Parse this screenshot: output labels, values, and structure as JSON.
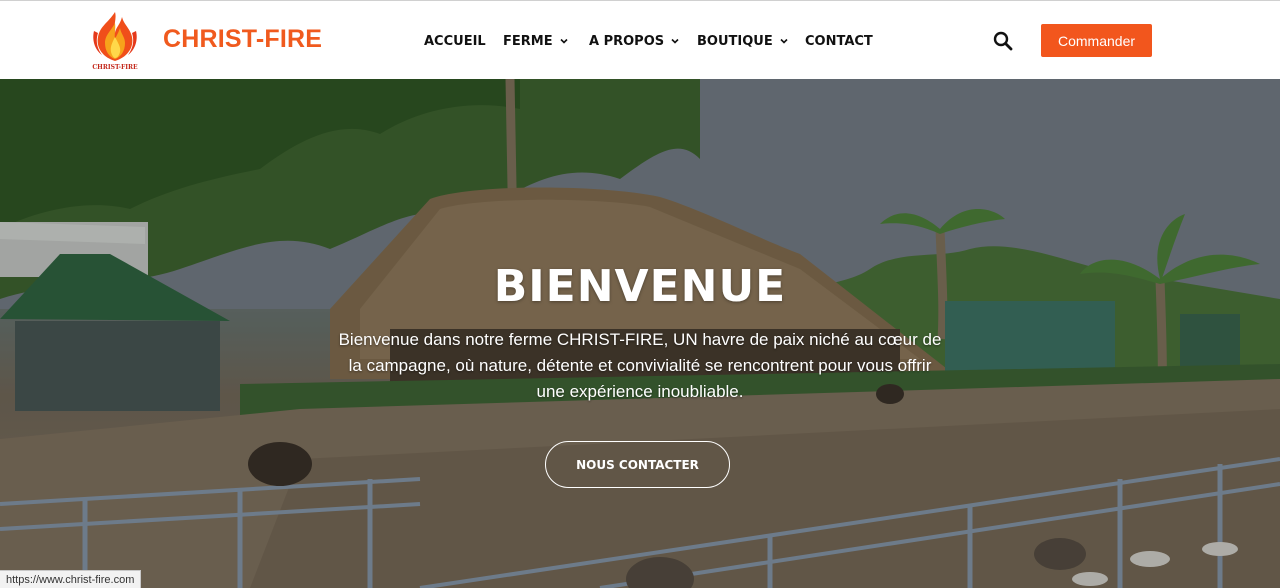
{
  "header": {
    "logo_caption": "CHRIST-FIRE",
    "brand": "CHRIST-FIRE",
    "nav": [
      {
        "label": "ACCUEIL",
        "dropdown": false
      },
      {
        "label": "FERME",
        "dropdown": true
      },
      {
        "label": "A PROPOS",
        "dropdown": true
      },
      {
        "label": "BOUTIQUE",
        "dropdown": true
      },
      {
        "label": "CONTACT",
        "dropdown": false
      }
    ],
    "search_icon": "search-icon",
    "order_label": "Commander"
  },
  "hero": {
    "title": "BIENVENUE",
    "text": "Bienvenue dans notre ferme CHRIST-FIRE, UN havre de paix niché au cœur de la campagne, où nature, détente et convivialité se rencontrent pour vous offrir une expérience inoubliable.",
    "cta_label": "NOUS CONTACTER"
  },
  "status_bar": {
    "url": "https://www.christ-fire.com"
  },
  "colors": {
    "brand": "#f05a1e",
    "button": "#f2561d"
  }
}
